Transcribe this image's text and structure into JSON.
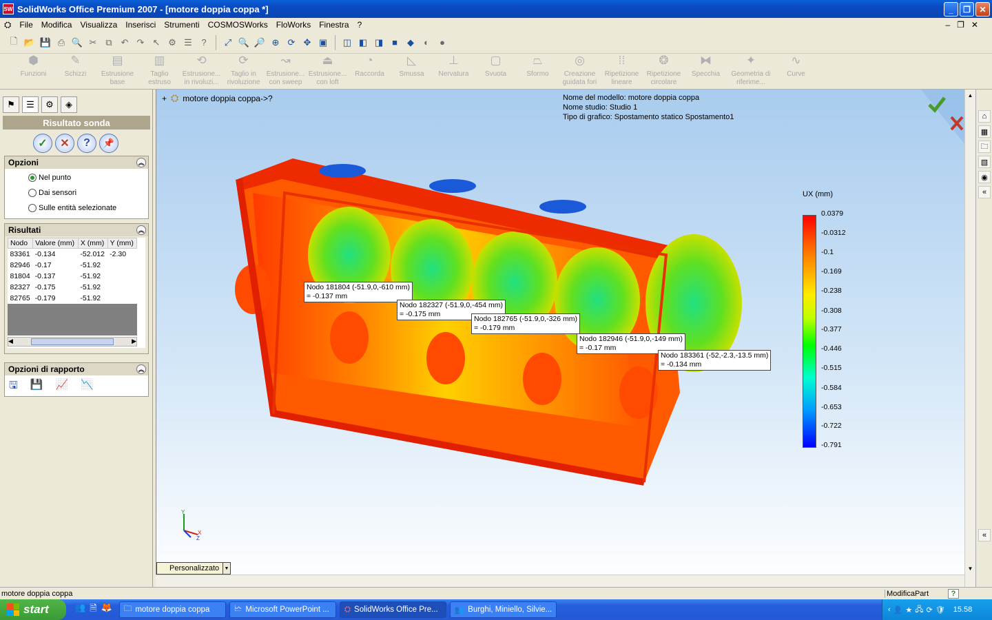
{
  "window": {
    "title": "SolidWorks Office Premium 2007 - [motore doppia coppa *]",
    "app_icon": "SW",
    "buttons": [
      "minimize-icon",
      "restore-icon",
      "close-icon"
    ]
  },
  "menu": [
    "File",
    "Modifica",
    "Visualizza",
    "Inserisci",
    "Strumenti",
    "COSMOSWorks",
    "FloWorks",
    "Finestra",
    "?"
  ],
  "features_toolbar": [
    {
      "label": "Funzioni",
      "icon": "features-icon"
    },
    {
      "label": "Schizzi",
      "icon": "sketch-icon"
    },
    {
      "label": "Estrusione base",
      "icon": "extrude-icon"
    },
    {
      "label": "Taglio estruso",
      "icon": "cut-extrude-icon"
    },
    {
      "label": "Estrusione... in rivoluzi...",
      "icon": "revolve-icon"
    },
    {
      "label": "Taglio in rivoluzione",
      "icon": "revolve-cut-icon"
    },
    {
      "label": "Estrusione... con sweep",
      "icon": "sweep-icon"
    },
    {
      "label": "Estrusione... con loft",
      "icon": "loft-icon"
    },
    {
      "label": "Raccorda",
      "icon": "fillet-icon"
    },
    {
      "label": "Smussa",
      "icon": "chamfer-icon"
    },
    {
      "label": "Nervatura",
      "icon": "rib-icon"
    },
    {
      "label": "Svuota",
      "icon": "shell-icon"
    },
    {
      "label": "Sformo",
      "icon": "draft-icon"
    },
    {
      "label": "Creazione guidata fori",
      "icon": "hole-wizard-icon"
    },
    {
      "label": "Ripetizione lineare",
      "icon": "linear-pattern-icon"
    },
    {
      "label": "Ripetizione circolare",
      "icon": "circular-pattern-icon"
    },
    {
      "label": "Specchia",
      "icon": "mirror-icon"
    },
    {
      "label": "Geometria di riferime...",
      "icon": "reference-geometry-icon"
    },
    {
      "label": "Curve",
      "icon": "curves-icon"
    }
  ],
  "panel": {
    "title": "Risultato sonda",
    "options": {
      "header": "Opzioni",
      "items": [
        {
          "label": "Nel punto",
          "selected": true
        },
        {
          "label": "Dai sensori",
          "selected": false
        },
        {
          "label": "Sulle entità selezionate",
          "selected": false
        }
      ]
    },
    "results": {
      "header": "Risultati",
      "columns": [
        "Nodo",
        "Valore (mm)",
        "X (mm)",
        "Y (mm)"
      ],
      "rows": [
        [
          "83361",
          "-0.134",
          "-52.012",
          "-2.30"
        ],
        [
          "82946",
          "-0.17",
          "-51.92",
          ""
        ],
        [
          "81804",
          "-0.137",
          "-51.92",
          ""
        ],
        [
          "82327",
          "-0.175",
          "-51.92",
          ""
        ],
        [
          "82765",
          "-0.179",
          "-51.92",
          ""
        ]
      ]
    },
    "report": {
      "header": "Opzioni di rapporto"
    }
  },
  "viewport": {
    "breadcrumb": "motore doppia coppa->?",
    "info_lines": [
      "Nome del modello: motore doppia coppa",
      "Nome studio: Studio 1",
      "Tipo di grafico: Spostamento statico Spostamento1"
    ],
    "legend_title": "UX (mm)",
    "legend_values": [
      "0.0379",
      "-0.0312",
      "-0.1",
      "-0.169",
      "-0.238",
      "-0.308",
      "-0.377",
      "-0.446",
      "-0.515",
      "-0.584",
      "-0.653",
      "-0.722",
      "-0.791"
    ],
    "probes": [
      {
        "line1": "Nodo 181804 (-51.9,0,-610 mm)",
        "line2": " = -0.137     mm"
      },
      {
        "line1": "Nodo 182327 (-51.9,0,-454 mm)",
        "line2": " = -0.175     mm"
      },
      {
        "line1": "Nodo 182765 (-51.9,0,-326 mm)",
        "line2": " = -0.179     mm"
      },
      {
        "line1": "Nodo 182946 (-51.9,0,-149 mm)",
        "line2": " = -0.17     mm"
      },
      {
        "line1": "Nodo 183361 (-52,-2.3,-13.5 mm)",
        "line2": " = -0.134     mm"
      }
    ],
    "view_mode": "Personalizzato",
    "axes": [
      "Y",
      "X",
      "Z"
    ]
  },
  "statusbar": {
    "left": "motore doppia coppa",
    "right": "ModificaPart",
    "help": "?"
  },
  "taskbar": {
    "start": "start",
    "tasks": [
      {
        "label": "motore doppia coppa",
        "icon": "folder-icon"
      },
      {
        "label": "Microsoft PowerPoint ...",
        "icon": "powerpoint-icon"
      },
      {
        "label": "SolidWorks Office Pre...",
        "icon": "solidworks-icon"
      },
      {
        "label": "Burghi, Miniello, Silvie...",
        "icon": "users-icon"
      }
    ],
    "clock": "15.58"
  },
  "colors": {
    "titlebar": "#0b4ac0",
    "legend_max": "#ff0000",
    "legend_min": "#0000ff",
    "accept": "#4a9a2e",
    "reject": "#c0392b"
  }
}
